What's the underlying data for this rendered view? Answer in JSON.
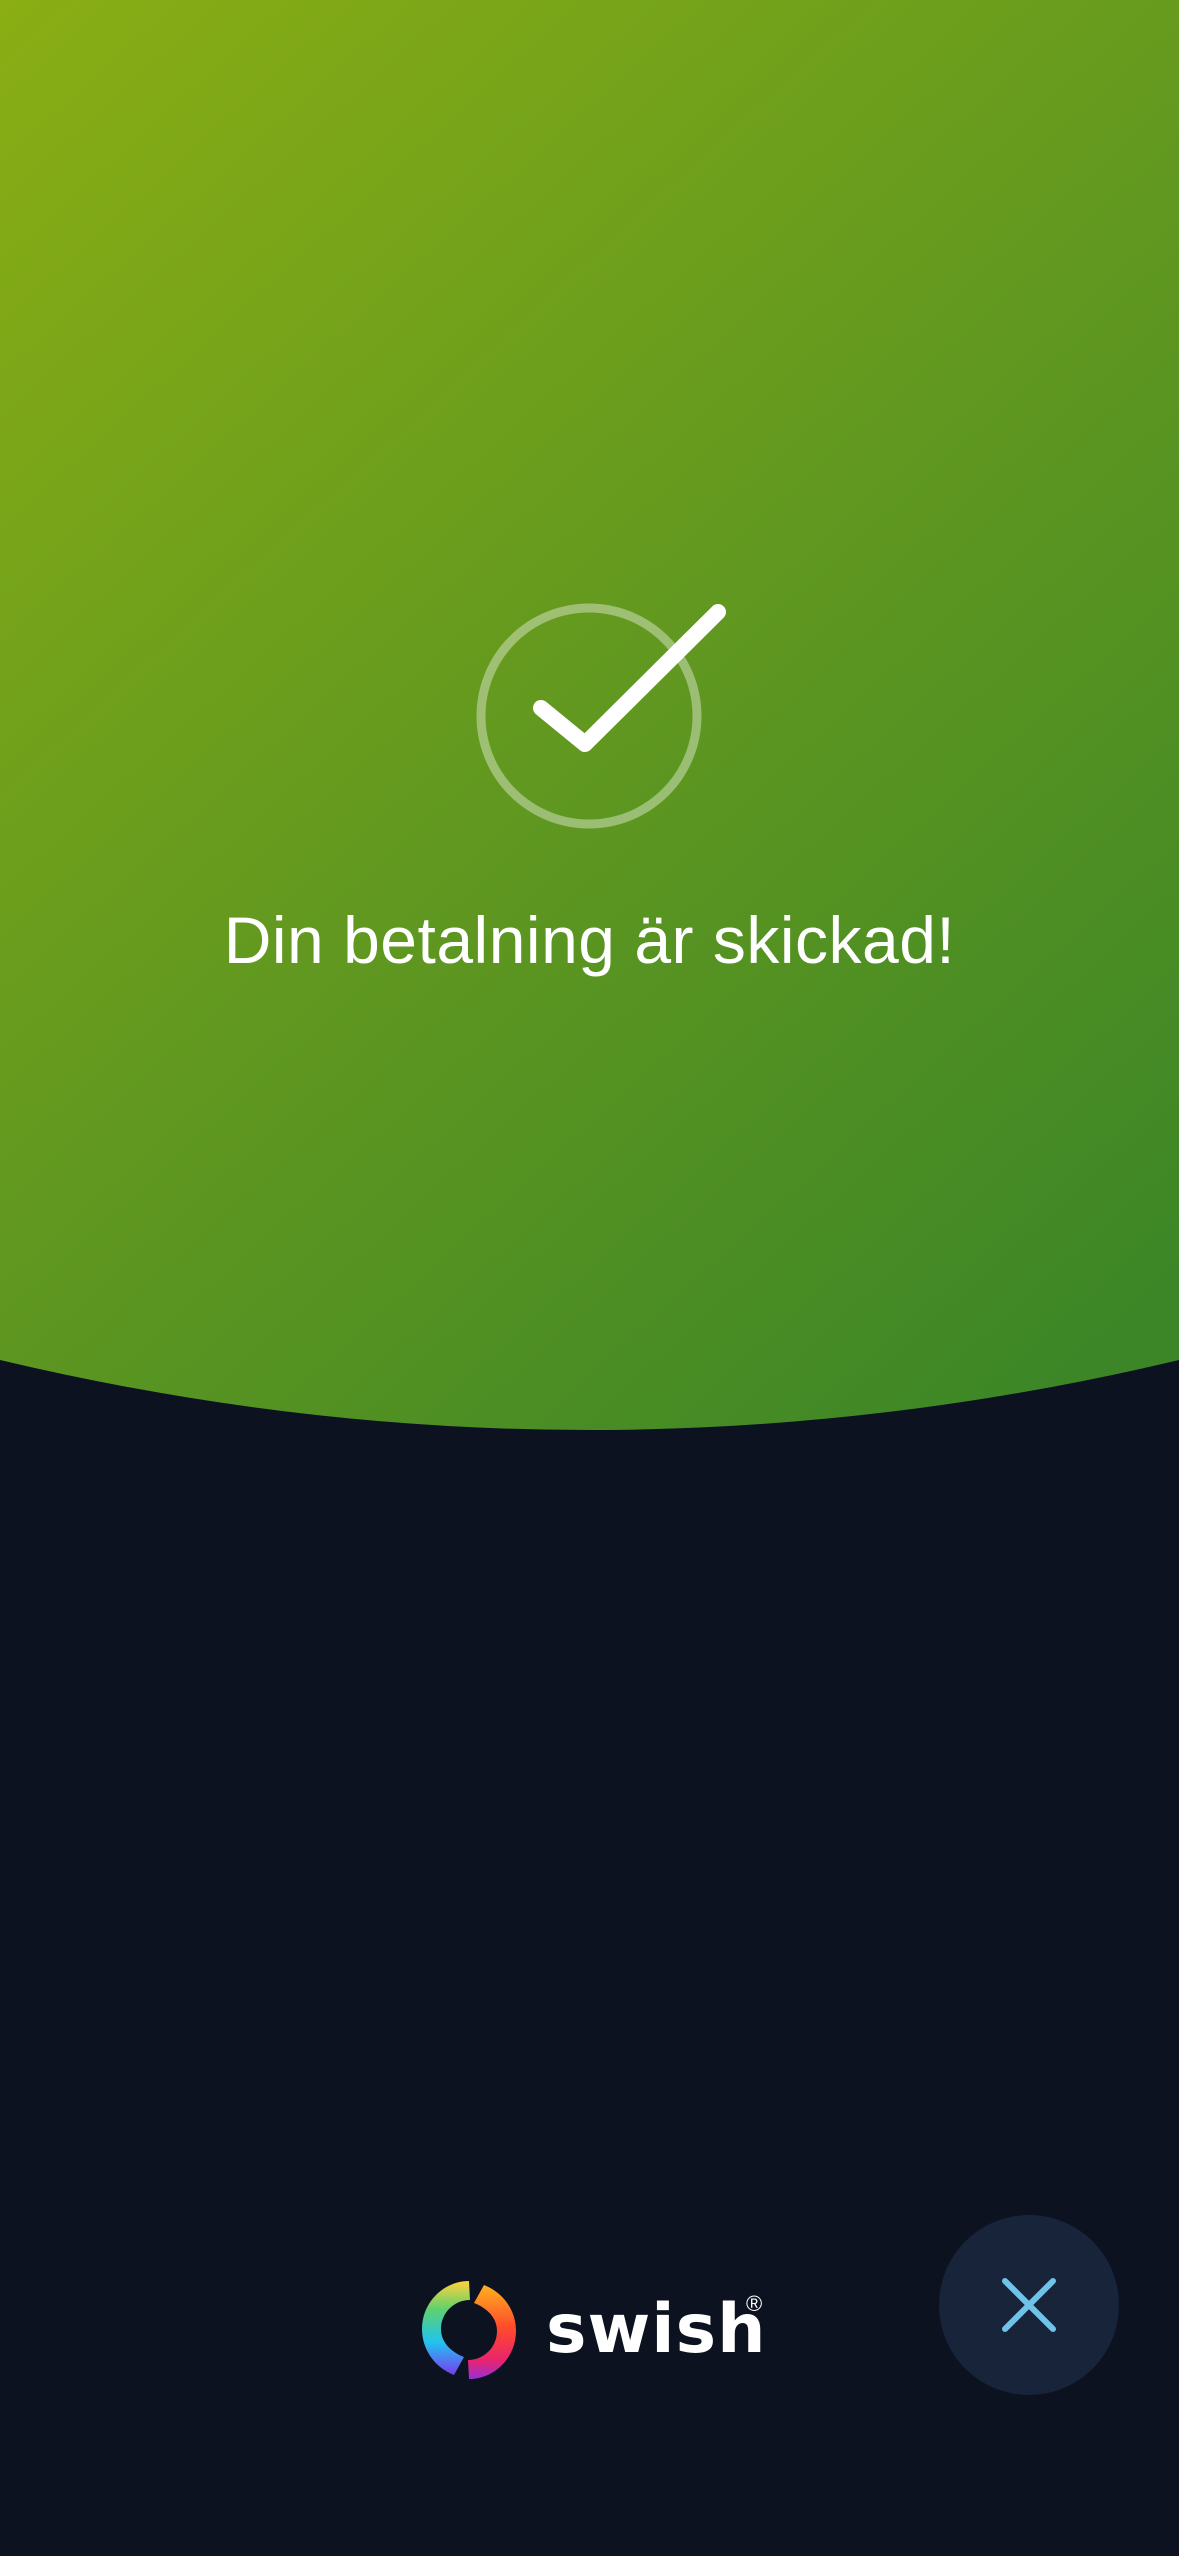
{
  "success": {
    "title": "Din betalning är skickad!",
    "icon": "check-circle-icon"
  },
  "brand": {
    "name": "swish",
    "registered_mark": "®",
    "logo_icon": "swish-logo-icon"
  },
  "close_button": {
    "icon": "close-icon",
    "icon_color": "#6fc3e8"
  },
  "colors": {
    "gradient_start": "#8aae14",
    "gradient_end": "#3c8627",
    "background_dark": "#0c1220",
    "close_button_bg": "#18243a",
    "text": "#ffffff"
  }
}
